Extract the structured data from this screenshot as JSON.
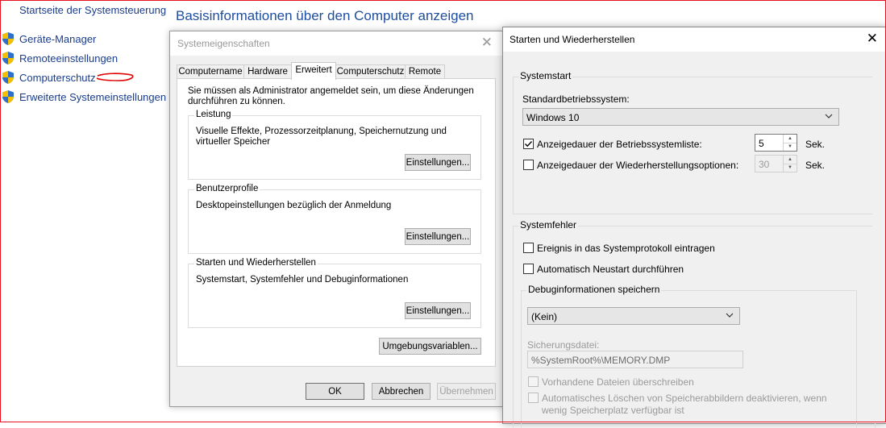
{
  "control_panel": {
    "home_link": "Startseite der Systemsteuerung",
    "links": [
      {
        "label": "Geräte-Manager"
      },
      {
        "label": "Remoteeinstellungen"
      },
      {
        "label": "Computerschutz"
      },
      {
        "label": "Erweiterte Systemeinstellungen"
      }
    ],
    "page_title": "Basisinformationen über den Computer anzeigen"
  },
  "system_properties": {
    "title": "Systemeigenschaften",
    "close_glyph": "✕",
    "tabs": [
      {
        "label": "Computername"
      },
      {
        "label": "Hardware"
      },
      {
        "label": "Erweitert",
        "active": true
      },
      {
        "label": "Computerschutz"
      },
      {
        "label": "Remote"
      }
    ],
    "admin_note": "Sie müssen als Administrator angemeldet sein, um diese Änderungen durchführen zu können.",
    "groups": [
      {
        "caption": "Leistung",
        "description": "Visuelle Effekte, Prozessorzeitplanung, Speichernutzung und virtueller Speicher",
        "button": "Einstellungen..."
      },
      {
        "caption": "Benutzerprofile",
        "description": "Desktopeinstellungen bezüglich der Anmeldung",
        "button": "Einstellungen..."
      },
      {
        "caption": "Starten und Wiederherstellen",
        "description": "Systemstart, Systemfehler und Debuginformationen",
        "button": "Einstellungen..."
      }
    ],
    "env_button": "Umgebungsvariablen...",
    "ok": "OK",
    "cancel": "Abbrechen",
    "apply": "Übernehmen"
  },
  "startup_recovery": {
    "title": "Starten und Wiederherstellen",
    "close_glyph": "✕",
    "systemstart": {
      "caption": "Systemstart",
      "default_os_label": "Standardbetriebssystem:",
      "default_os_value": "Windows 10",
      "show_list_label": "Anzeigedauer der Betriebssystemliste:",
      "show_list_checked": true,
      "show_list_value": "5",
      "show_recovery_label": "Anzeigedauer der Wiederherstellungsoptionen:",
      "show_recovery_checked": false,
      "show_recovery_value": "30",
      "unit": "Sek."
    },
    "systemfehler": {
      "caption": "Systemfehler",
      "log_event_label": "Ereignis in das Systemprotokoll eintragen",
      "auto_restart_label": "Automatisch Neustart durchführen",
      "debug_caption": "Debuginformationen speichern",
      "debug_value": "(Kein)",
      "dump_file_label": "Sicherungsdatei:",
      "dump_file_value": "%SystemRoot%\\MEMORY.DMP",
      "overwrite_label": "Vorhandene Dateien überschreiben",
      "auto_delete_label": "Automatisches Löschen von Speicherabbildern deaktivieren, wenn wenig Speicherplatz verfügbar ist"
    }
  }
}
